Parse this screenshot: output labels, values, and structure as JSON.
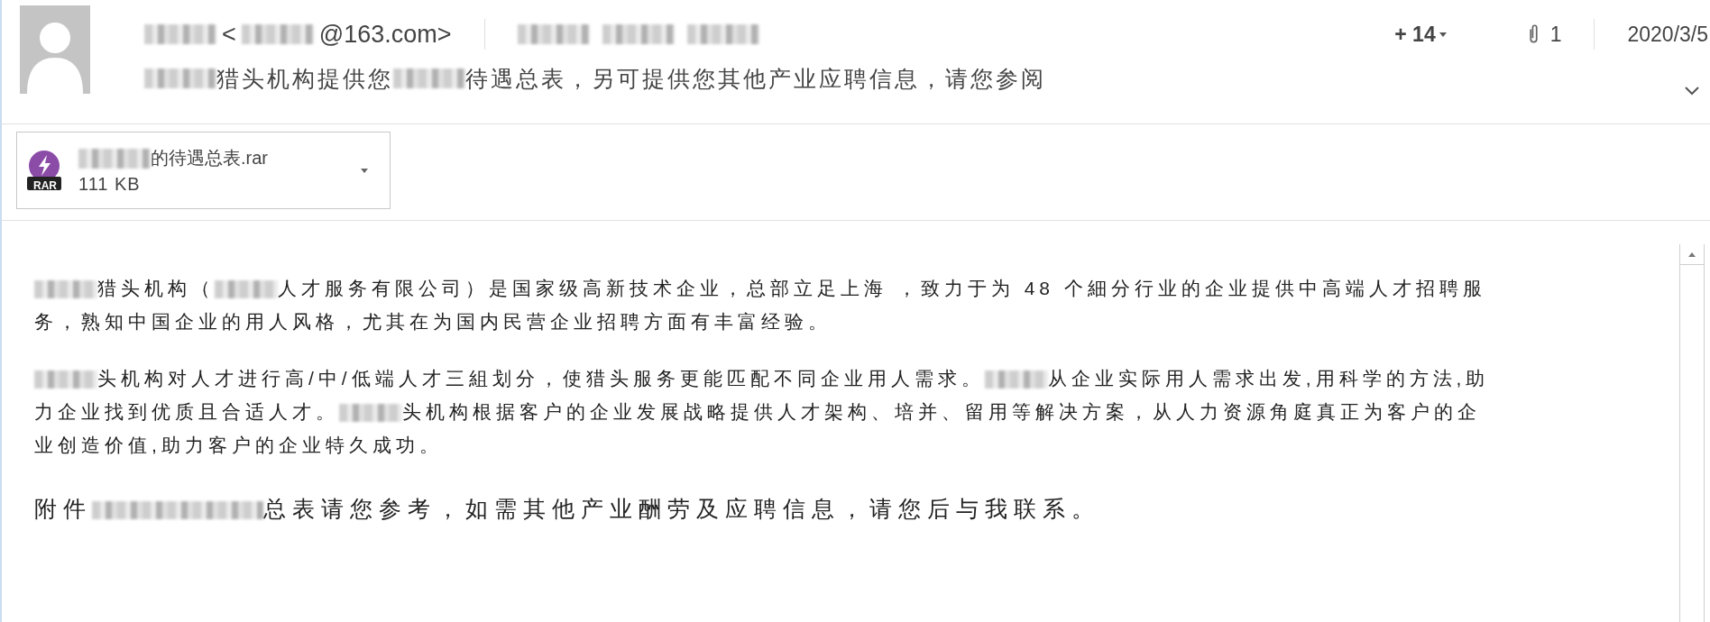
{
  "header": {
    "sender": [
      {
        "kind": "blur"
      },
      {
        "kind": "text",
        "text": "<"
      },
      {
        "kind": "blur"
      },
      {
        "kind": "text",
        "text": "@163.com>"
      }
    ],
    "recipients": [
      {
        "kind": "blur"
      },
      {
        "kind": "blur"
      },
      {
        "kind": "blur"
      }
    ],
    "more_recipients": "+ 14",
    "attachment_count": "1",
    "date": "2020/3/5",
    "subject": [
      {
        "kind": "blur"
      },
      {
        "kind": "text",
        "text": "猎头机构提供您"
      },
      {
        "kind": "blur"
      },
      {
        "kind": "text",
        "text": "待遇总表，另可提供您其他产业应聘信息，请您参阅"
      }
    ]
  },
  "attachment": {
    "badge": "RAR",
    "name": [
      {
        "kind": "blur"
      },
      {
        "kind": "text",
        "text": "的待遇总表.rar"
      }
    ],
    "size": "111 KB"
  },
  "body": [
    {
      "kind": "normal",
      "lines": [
        [
          {
            "kind": "blur"
          },
          {
            "kind": "text",
            "text": "猎头机构（"
          },
          {
            "kind": "blur"
          },
          {
            "kind": "text",
            "text": "人才服务有限公司）是国家级高新技术企业，总部立足上海 ，致力于为 48 个細分行业的企业提供中高端人才招聘服"
          }
        ],
        [
          {
            "kind": "text",
            "text": "务，熟知中国企业的用人风格，尤其在为国内民营企业招聘方面有丰富经验。"
          }
        ]
      ]
    },
    {
      "kind": "normal",
      "lines": [
        [
          {
            "kind": "blur"
          },
          {
            "kind": "text",
            "text": "头机构对人才进行高/中/低端人才三組划分，使猎头服务更能匹配不同企业用人需求。"
          },
          {
            "kind": "blur"
          },
          {
            "kind": "text",
            "text": "从企业实际用人需求出发,用科学的方法,助"
          }
        ],
        [
          {
            "kind": "text",
            "text": "力企业找到优质且合适人才。"
          },
          {
            "kind": "blur"
          },
          {
            "kind": "text",
            "text": "头机构根据客户的企业发展战略提供人才架构、培并、留用等解决方案，从人力资源角庭真正为客户的企"
          }
        ],
        [
          {
            "kind": "text",
            "text": "业创造价值,助力客户的企业特久成功。"
          }
        ]
      ]
    },
    {
      "kind": "large",
      "lines": [
        [
          {
            "kind": "text",
            "text": "附件"
          },
          {
            "kind": "blur"
          },
          {
            "kind": "text",
            "text": "总表请您参考，如需其他产业酬劳及应聘信息，请您后与我联系。"
          }
        ]
      ]
    }
  ]
}
